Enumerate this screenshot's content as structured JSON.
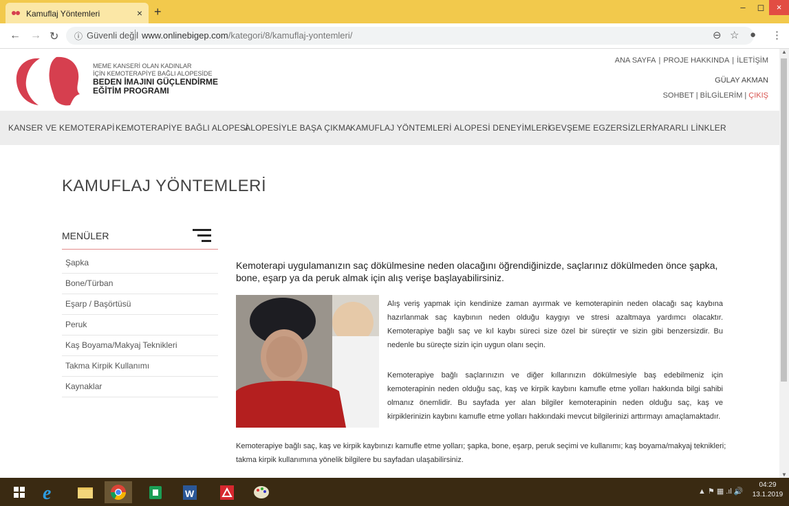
{
  "browser": {
    "tab_title": "Kamuflaj Yöntemleri",
    "tab_close": "×",
    "new_tab": "+",
    "security_label": "Güvenli değil",
    "url_host": "www.onlinebigep.com",
    "url_path": "/kategori/8/kamuflaj-yontemleri/",
    "window_controls": {
      "minimize": "–",
      "maximize": "◻",
      "close": "×"
    }
  },
  "site": {
    "brand_line1": "MEME KANSERİ OLAN KADINLAR",
    "brand_line2": "İÇİN KEMOTERAPİYE BAĞLI ALOPESİDE",
    "brand_line3": "BEDEN İMAJINI GÜÇLENDİRME",
    "brand_line4": "EĞİTİM PROGRAMI",
    "top_links": [
      "ANA SAYFA",
      "PROJE HAKKINDA",
      "İLETİŞİM"
    ],
    "top_sep": "|",
    "user_name": "GÜLAY AKMAN",
    "user_links": [
      "SOHBET",
      "BİLGİLERİM",
      "ÇIKIŞ"
    ],
    "nav": [
      "KANSER VE KEMOTERAPİ",
      "KEMOTERAPİYE BAĞLI ALOPESİ",
      "ALOPESİYLE BAŞA ÇIKMA",
      "KAMUFLAJ YÖNTEMLERİ",
      "ALOPESİ DENEYİMLERİ",
      "GEVŞEME EGZERSİZLERİ",
      "YARARLI LİNKLER"
    ]
  },
  "main": {
    "title": "KAMUFLAJ YÖNTEMLERİ",
    "menu_heading": "MENÜLER",
    "menu_items": [
      "Şapka",
      "Bone/Türban",
      "Eşarp / Başörtüsü",
      "Peruk",
      "Kaş Boyama/Makyaj Teknikleri",
      "Takma Kirpik Kullanımı",
      "Kaynaklar"
    ],
    "lead": "Kemoterapi uygulamanızın saç dökülmesine neden olacağını öğrendiğinizde, saçlarınız dökülmeden önce şapka, bone, eşarp ya da peruk almak için alış verişe başlayabilirsiniz.",
    "p1": "Alış veriş yapmak için kendinize zaman ayırmak ve kemoterapinin neden olacağı saç kaybına hazırlanmak saç kaybının neden olduğu kaygıyı ve stresi azaltmaya yardımcı olacaktır. Kemoterapiye bağlı saç ve kıl kaybı süreci size özel bir süreçtir ve sizin gibi benzersizdir. Bu nedenle bu süreçte sizin için uygun olanı seçin.",
    "p2": "Kemoterapiye bağlı saçlarınızın ve diğer kıllarınızın dökülmesiyle baş edebilmeniz için kemoterapinin neden olduğu saç, kaş ve kirpik kaybını kamufle etme yolları hakkında bilgi sahibi olmanız önemlidir. Bu sayfada yer alan bilgiler kemoterapinin neden olduğu saç, kaş ve kirpiklerinizin kaybını kamufle etme yolları hakkındaki mevcut bilgilerinizi arttırmayı amaçlamaktadır.",
    "p3": "Kemoterapiye bağlı saç, kaş ve kirpik kaybınızı kamufle etme yolları; şapka, bone, eşarp, peruk seçimi ve kullanımı; kaş boyama/makyaj teknikleri; takma kirpik kullanımına yönelik bilgilere bu sayfadan ulaşabilirsiniz."
  },
  "taskbar": {
    "time": "04:29",
    "date": "13.1.2019",
    "tray": "▲  ⚑  ▦  .ıl  🔊"
  }
}
